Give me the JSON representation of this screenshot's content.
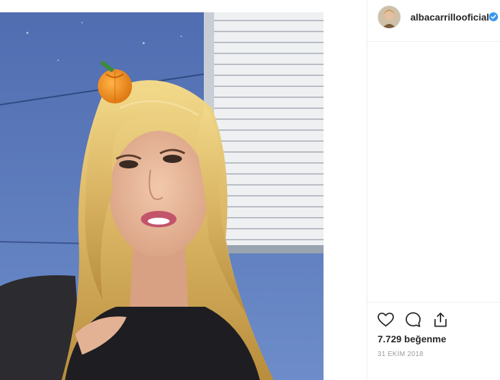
{
  "post": {
    "username": "albacarrillooficial",
    "likes_text": "7.729 beğenme",
    "date_text": "31 EKİM 2018"
  },
  "icons": {
    "avatar": "profile-avatar",
    "verified": "verified-badge-icon",
    "like": "heart-icon",
    "comment": "comment-bubble-icon",
    "share": "share-upload-icon"
  },
  "colors": {
    "accent": "#3897f0",
    "text": "#262626",
    "muted": "#999999",
    "border": "#efefef"
  }
}
